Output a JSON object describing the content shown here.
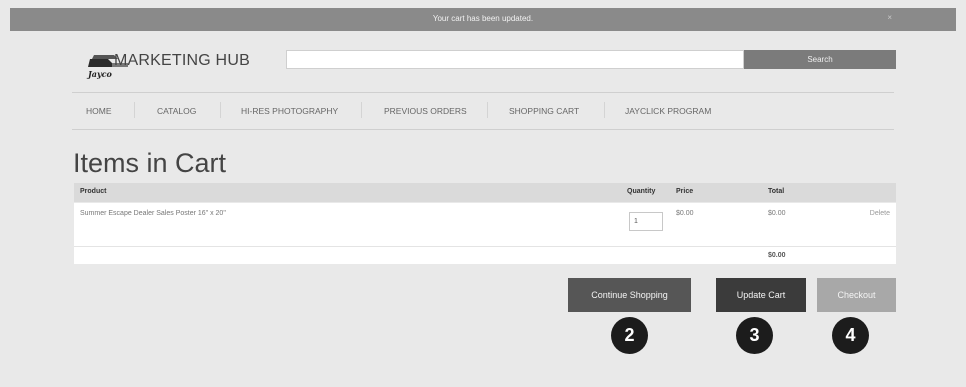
{
  "notice": {
    "text": "Your cart has been updated.",
    "close_glyph": "×"
  },
  "header": {
    "logo_text": "Jayco",
    "brand": "MARKETING HUB",
    "search_placeholder": "",
    "search_label": "Search"
  },
  "nav": {
    "items": [
      "HOME",
      "CATALOG",
      "HI-RES PHOTOGRAPHY",
      "PREVIOUS ORDERS",
      "SHOPPING CART",
      "JAYCLICK PROGRAM"
    ]
  },
  "cart": {
    "title": "Items in Cart",
    "columns": {
      "product": "Product",
      "quantity": "Quantity",
      "price": "Price",
      "total": "Total"
    },
    "items": [
      {
        "product": "Summer Escape Dealer Sales Poster 16\" x 20\"",
        "quantity": "1",
        "price": "$0.00",
        "total": "$0.00",
        "action": "Delete"
      }
    ],
    "grand_total": "$0.00"
  },
  "actions": {
    "continue": "Continue Shopping",
    "update": "Update Cart",
    "checkout": "Checkout"
  },
  "badges": [
    "2",
    "3",
    "4"
  ],
  "colors": {
    "notice_bar": "#8a8a8a",
    "continue_button": "#565656",
    "update_button": "#3b3b3b",
    "checkout_button": "#a8a8a8",
    "badge": "#1c1c1c"
  },
  "icons": {
    "logo": "jayco-logo-icon"
  }
}
